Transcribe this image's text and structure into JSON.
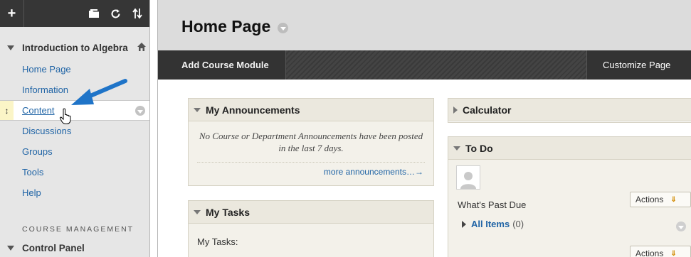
{
  "sidebar": {
    "toolbar": {
      "add": "+",
      "folder_icon": "folder-icon",
      "refresh_icon": "refresh-icon",
      "sort_icon": "sort-icon"
    },
    "course_title": "Introduction to Algebra",
    "items": [
      {
        "label": "Home Page",
        "active": false
      },
      {
        "label": "Information",
        "active": false
      },
      {
        "label": "Content",
        "active": true
      },
      {
        "label": "Discussions",
        "active": false
      },
      {
        "label": "Groups",
        "active": false
      },
      {
        "label": "Tools",
        "active": false
      },
      {
        "label": "Help",
        "active": false
      }
    ],
    "management_label": "COURSE MANAGEMENT",
    "control_panel": "Control Panel"
  },
  "page": {
    "title": "Home Page"
  },
  "action_bar": {
    "add_module": "Add Course Module",
    "customize": "Customize Page"
  },
  "modules": {
    "announcements": {
      "title": "My Announcements",
      "message": "No Course or Department Announcements have been posted in the last 7 days.",
      "more_link": "more announcements…→"
    },
    "tasks": {
      "title": "My Tasks",
      "label": "My Tasks:"
    },
    "calculator": {
      "title": "Calculator"
    },
    "todo": {
      "title": "To Do",
      "past_due": "What's Past Due",
      "actions_label": "Actions",
      "all_items_label": "All Items",
      "all_items_count": "(0)"
    }
  },
  "colors": {
    "link": "#2165a6",
    "sidebar_bg": "#e6e6e6",
    "toolbar_bg": "#363636",
    "module_header_bg": "#ebe8de",
    "arrow": "#1f74c8"
  }
}
